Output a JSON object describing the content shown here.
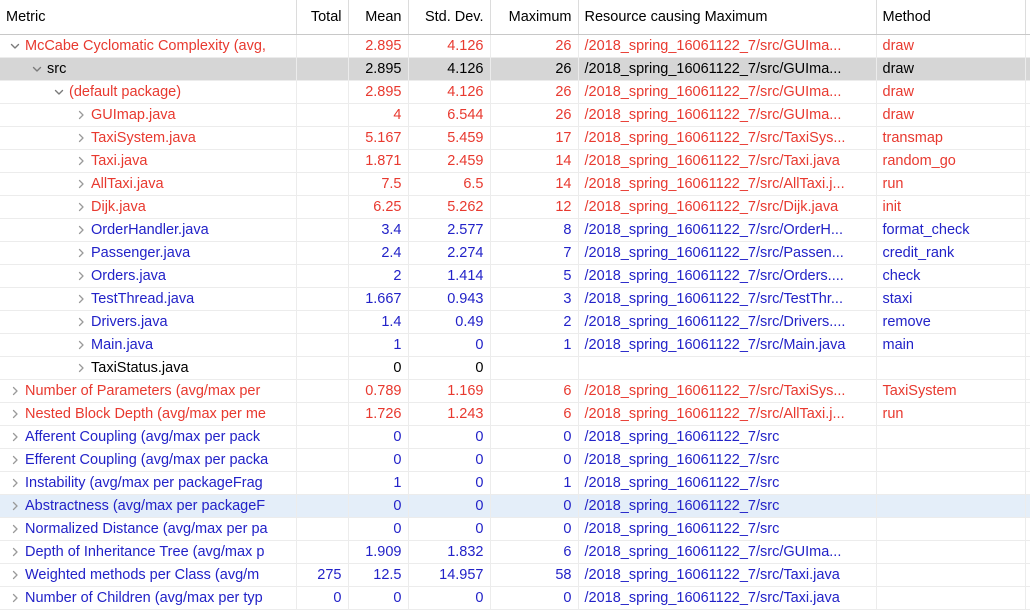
{
  "view": {
    "name": "Metrics View",
    "colors": {
      "red": "#e8392f",
      "blue": "#2222c8",
      "black": "#000000",
      "selected_row": "#d6d6d6",
      "hover_row": "#e4eef9",
      "grid": "#ececec",
      "header_rule": "#c8c8c8"
    }
  },
  "columns": [
    {
      "key": "metric",
      "label": "Metric",
      "align": "left"
    },
    {
      "key": "total",
      "label": "Total",
      "align": "right"
    },
    {
      "key": "mean",
      "label": "Mean",
      "align": "right"
    },
    {
      "key": "stddev",
      "label": "Std. Dev.",
      "align": "right"
    },
    {
      "key": "maximum",
      "label": "Maximum",
      "align": "right"
    },
    {
      "key": "resource",
      "label": "Resource causing Maximum",
      "align": "left"
    },
    {
      "key": "method",
      "label": "Method",
      "align": "left"
    }
  ],
  "rows": [
    {
      "metric": "McCabe Cyclomatic Complexity (avg,",
      "total": "",
      "mean": "2.895",
      "stddev": "4.126",
      "maximum": "26",
      "resource": "/2018_spring_16061122_7/src/GUIma...",
      "method": "draw",
      "indent": 0,
      "twisty": "expanded",
      "color": "red",
      "state": "normal"
    },
    {
      "metric": "src",
      "total": "",
      "mean": "2.895",
      "stddev": "4.126",
      "maximum": "26",
      "resource": "/2018_spring_16061122_7/src/GUIma...",
      "method": "draw",
      "indent": 1,
      "twisty": "expanded",
      "color": "black",
      "state": "selected"
    },
    {
      "metric": "(default package)",
      "total": "",
      "mean": "2.895",
      "stddev": "4.126",
      "maximum": "26",
      "resource": "/2018_spring_16061122_7/src/GUIma...",
      "method": "draw",
      "indent": 2,
      "twisty": "expanded",
      "color": "red",
      "state": "normal"
    },
    {
      "metric": "GUImap.java",
      "total": "",
      "mean": "4",
      "stddev": "6.544",
      "maximum": "26",
      "resource": "/2018_spring_16061122_7/src/GUIma...",
      "method": "draw",
      "indent": 3,
      "twisty": "collapsed",
      "color": "red",
      "state": "normal"
    },
    {
      "metric": "TaxiSystem.java",
      "total": "",
      "mean": "5.167",
      "stddev": "5.459",
      "maximum": "17",
      "resource": "/2018_spring_16061122_7/src/TaxiSys...",
      "method": "transmap",
      "indent": 3,
      "twisty": "collapsed",
      "color": "red",
      "state": "normal"
    },
    {
      "metric": "Taxi.java",
      "total": "",
      "mean": "1.871",
      "stddev": "2.459",
      "maximum": "14",
      "resource": "/2018_spring_16061122_7/src/Taxi.java",
      "method": "random_go",
      "indent": 3,
      "twisty": "collapsed",
      "color": "red",
      "state": "normal"
    },
    {
      "metric": "AllTaxi.java",
      "total": "",
      "mean": "7.5",
      "stddev": "6.5",
      "maximum": "14",
      "resource": "/2018_spring_16061122_7/src/AllTaxi.j...",
      "method": "run",
      "indent": 3,
      "twisty": "collapsed",
      "color": "red",
      "state": "normal"
    },
    {
      "metric": "Dijk.java",
      "total": "",
      "mean": "6.25",
      "stddev": "5.262",
      "maximum": "12",
      "resource": "/2018_spring_16061122_7/src/Dijk.java",
      "method": "init",
      "indent": 3,
      "twisty": "collapsed",
      "color": "red",
      "state": "normal"
    },
    {
      "metric": "OrderHandler.java",
      "total": "",
      "mean": "3.4",
      "stddev": "2.577",
      "maximum": "8",
      "resource": "/2018_spring_16061122_7/src/OrderH...",
      "method": "format_check",
      "indent": 3,
      "twisty": "collapsed",
      "color": "blue",
      "state": "normal"
    },
    {
      "metric": "Passenger.java",
      "total": "",
      "mean": "2.4",
      "stddev": "2.274",
      "maximum": "7",
      "resource": "/2018_spring_16061122_7/src/Passen...",
      "method": "credit_rank",
      "indent": 3,
      "twisty": "collapsed",
      "color": "blue",
      "state": "normal"
    },
    {
      "metric": "Orders.java",
      "total": "",
      "mean": "2",
      "stddev": "1.414",
      "maximum": "5",
      "resource": "/2018_spring_16061122_7/src/Orders....",
      "method": "check",
      "indent": 3,
      "twisty": "collapsed",
      "color": "blue",
      "state": "normal"
    },
    {
      "metric": "TestThread.java",
      "total": "",
      "mean": "1.667",
      "stddev": "0.943",
      "maximum": "3",
      "resource": "/2018_spring_16061122_7/src/TestThr...",
      "method": "staxi",
      "indent": 3,
      "twisty": "collapsed",
      "color": "blue",
      "state": "normal"
    },
    {
      "metric": "Drivers.java",
      "total": "",
      "mean": "1.4",
      "stddev": "0.49",
      "maximum": "2",
      "resource": "/2018_spring_16061122_7/src/Drivers....",
      "method": "remove",
      "indent": 3,
      "twisty": "collapsed",
      "color": "blue",
      "state": "normal"
    },
    {
      "metric": "Main.java",
      "total": "",
      "mean": "1",
      "stddev": "0",
      "maximum": "1",
      "resource": "/2018_spring_16061122_7/src/Main.java",
      "method": "main",
      "indent": 3,
      "twisty": "collapsed",
      "color": "blue",
      "state": "normal"
    },
    {
      "metric": "TaxiStatus.java",
      "total": "",
      "mean": "0",
      "stddev": "0",
      "maximum": "",
      "resource": "",
      "method": "",
      "indent": 3,
      "twisty": "collapsed",
      "color": "black",
      "state": "normal"
    },
    {
      "metric": "Number of Parameters (avg/max per",
      "total": "",
      "mean": "0.789",
      "stddev": "1.169",
      "maximum": "6",
      "resource": "/2018_spring_16061122_7/src/TaxiSys...",
      "method": "TaxiSystem",
      "indent": 0,
      "twisty": "collapsed",
      "color": "red",
      "state": "normal"
    },
    {
      "metric": "Nested Block Depth (avg/max per me",
      "total": "",
      "mean": "1.726",
      "stddev": "1.243",
      "maximum": "6",
      "resource": "/2018_spring_16061122_7/src/AllTaxi.j...",
      "method": "run",
      "indent": 0,
      "twisty": "collapsed",
      "color": "red",
      "state": "normal"
    },
    {
      "metric": "Afferent Coupling (avg/max per pack",
      "total": "",
      "mean": "0",
      "stddev": "0",
      "maximum": "0",
      "resource": "/2018_spring_16061122_7/src",
      "method": "",
      "indent": 0,
      "twisty": "collapsed",
      "color": "blue",
      "state": "normal"
    },
    {
      "metric": "Efferent Coupling (avg/max per packa",
      "total": "",
      "mean": "0",
      "stddev": "0",
      "maximum": "0",
      "resource": "/2018_spring_16061122_7/src",
      "method": "",
      "indent": 0,
      "twisty": "collapsed",
      "color": "blue",
      "state": "normal"
    },
    {
      "metric": "Instability (avg/max per packageFrag",
      "total": "",
      "mean": "1",
      "stddev": "0",
      "maximum": "1",
      "resource": "/2018_spring_16061122_7/src",
      "method": "",
      "indent": 0,
      "twisty": "collapsed",
      "color": "blue",
      "state": "normal"
    },
    {
      "metric": "Abstractness (avg/max per packageF",
      "total": "",
      "mean": "0",
      "stddev": "0",
      "maximum": "0",
      "resource": "/2018_spring_16061122_7/src",
      "method": "",
      "indent": 0,
      "twisty": "collapsed",
      "color": "blue",
      "state": "hover"
    },
    {
      "metric": "Normalized Distance (avg/max per pa",
      "total": "",
      "mean": "0",
      "stddev": "0",
      "maximum": "0",
      "resource": "/2018_spring_16061122_7/src",
      "method": "",
      "indent": 0,
      "twisty": "collapsed",
      "color": "blue",
      "state": "normal"
    },
    {
      "metric": "Depth of Inheritance Tree (avg/max p",
      "total": "",
      "mean": "1.909",
      "stddev": "1.832",
      "maximum": "6",
      "resource": "/2018_spring_16061122_7/src/GUIma...",
      "method": "",
      "indent": 0,
      "twisty": "collapsed",
      "color": "blue",
      "state": "normal"
    },
    {
      "metric": "Weighted methods per Class (avg/m",
      "total": "275",
      "mean": "12.5",
      "stddev": "14.957",
      "maximum": "58",
      "resource": "/2018_spring_16061122_7/src/Taxi.java",
      "method": "",
      "indent": 0,
      "twisty": "collapsed",
      "color": "blue",
      "state": "normal"
    },
    {
      "metric": "Number of Children (avg/max per typ",
      "total": "0",
      "mean": "0",
      "stddev": "0",
      "maximum": "0",
      "resource": "/2018_spring_16061122_7/src/Taxi.java",
      "method": "",
      "indent": 0,
      "twisty": "collapsed",
      "color": "blue",
      "state": "normal"
    }
  ]
}
